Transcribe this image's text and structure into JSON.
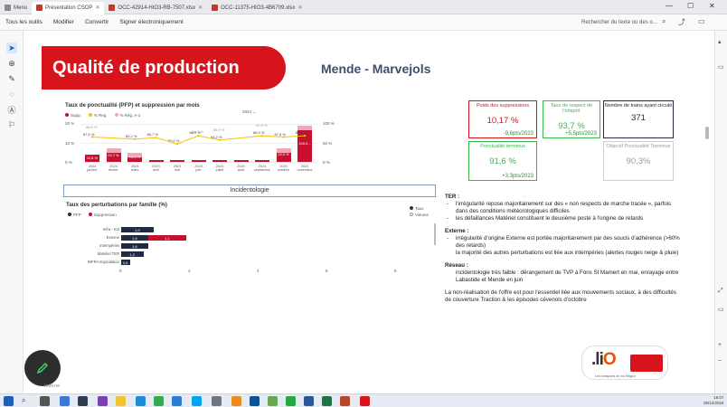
{
  "browser": {
    "tabs": [
      {
        "label": "Menu",
        "active": false
      },
      {
        "label": "Présentation CSOP",
        "active": true
      },
      {
        "label": "OCC-42914-HIO3-RB-7507.xlsx",
        "active": false
      },
      {
        "label": "OCC-11375-HIO3-4B6709.xlsx",
        "active": false
      }
    ]
  },
  "toolbar": {
    "items": [
      "Tous les outils",
      "Modifier",
      "Convertir",
      "Signer électroniquement"
    ],
    "search_placeholder": "Rechercher du texte ou des o..."
  },
  "slide": {
    "title": "Qualité de production",
    "subtitle": "Mende - Marvejols"
  },
  "bar_chart": {
    "title": "Taux de ponctualité (PFP) et suppression par mois",
    "year_filter": "2024",
    "legend": [
      "Supp.",
      "% Reg.",
      "% Rég. A-1"
    ],
    "y_ticks": [
      "20 %",
      "10 %",
      "0 %"
    ],
    "right_ticks": [
      "100 %",
      "50 %",
      "0 %"
    ]
  },
  "chart_data": {
    "type": "bar",
    "categories": [
      "janvier",
      "février",
      "mars",
      "avril",
      "mai",
      "juin",
      "juillet",
      "août",
      "septembre",
      "octobre",
      "novembre"
    ],
    "year": "2024",
    "series": [
      {
        "name": "Supp.",
        "values": [
          11.8,
          22.7,
          15.6,
          0.0,
          0.0,
          2.0,
          2.0,
          2.0,
          2.0,
          23.5,
          100.0
        ],
        "labels": [
          "11,8 %",
          "22,7 %",
          "15,6 %",
          "",
          "",
          "",
          "",
          "",
          "",
          "23,5 %",
          "100,0..."
        ]
      },
      {
        "name": "% Reg.",
        "values": [
          87.5,
          0,
          85.2,
          86.7,
          80.0,
          88.9,
          84.2,
          0,
          88.9,
          87.5,
          88.9
        ],
        "labels": [
          "87,5 %",
          "",
          "85,2 %",
          "86,7 %",
          "80,0 %",
          "88,9 %",
          "84,2 %",
          "",
          "88,9 %",
          "87,5 %",
          "88,9 %"
        ]
      },
      {
        "name": "% Rég. A-1",
        "values": [
          88.9,
          0,
          0,
          0,
          0,
          84.2,
          85.9,
          0,
          90.9,
          0,
          0
        ],
        "labels": [
          "88,9 %",
          "",
          "",
          "",
          "",
          "84,2 %",
          "85,9 %",
          "",
          "90,9 %",
          "",
          ""
        ]
      }
    ],
    "ylim": [
      0,
      20
    ],
    "y2lim": [
      0,
      100
    ]
  },
  "incident": {
    "header": "Incidentologie",
    "chart_title": "Taux des perturbations par famille (%)",
    "legend": [
      "PFP",
      "Suppression"
    ],
    "toggle": [
      "Taux",
      "Volume"
    ],
    "rows": [
      {
        "label": "Infra - Ext",
        "pfp": 1.9,
        "pfp_label": "1,9",
        "supp": 0,
        "supp_label": ""
      },
      {
        "label": "Externe",
        "pfp": 1.6,
        "pfp_label": "1,6",
        "supp": 1.1,
        "supp_label": "1,1"
      },
      {
        "label": "Intempéries",
        "pfp": 1.6,
        "pfp_label": "1,6",
        "supp": 0,
        "supp_label": ""
      },
      {
        "label": "Matériel TER",
        "pfp": 1.3,
        "pfp_label": "1,3",
        "supp": 0,
        "supp_label": ""
      },
      {
        "label": "INFRA Exploitation",
        "pfp": 0.5,
        "pfp_label": "0,5",
        "supp": 0,
        "supp_label": ""
      }
    ],
    "x_ticks": [
      "0",
      "2",
      "4",
      "6",
      "8"
    ]
  },
  "kpis": [
    {
      "title": "Poids des suppressions",
      "value": "10,17 %",
      "delta": "-9,6pts/2023",
      "color": "#d7141c",
      "value_color": "#d7141c",
      "delta_color": "#2e8b3e"
    },
    {
      "title": "Taux de respect de l'emport",
      "value": "93,7 %",
      "delta": "+5,5pts/2023",
      "color": "#3cb54a",
      "value_color": "#3cb54a",
      "delta_color": "#2e8b3e"
    },
    {
      "title": "Nombre de trains ayant circulé",
      "value": "371",
      "delta": "",
      "color": "#1f2a44",
      "value_color": "#1f2a44",
      "delta_color": "#333"
    },
    {
      "title": "Ponctualité terminus",
      "value": "91,6 %",
      "delta": "+3,3pts/2023",
      "color": "#3cb54a",
      "value_color": "#3cb54a",
      "delta_color": "#2e8b3e"
    },
    {
      "title": "Objectif Ponctualité Terminus",
      "value": "90,3%",
      "delta": "",
      "color": "#cfcfcf",
      "value_color": "#9a9a9a",
      "delta_color": "#999"
    }
  ],
  "text": {
    "ter_title": "TER :",
    "ter_items": [
      "l'irrégularité repose majoritairement sur des « non respects de marche tracée », parfois dans des conditions météorologiques difficiles",
      "les défaillances Matériel constituent le deuxième poste à l'origine de retards"
    ],
    "externe_title": "Externe :",
    "externe_items": [
      "irrégularité d'origine Externe est portée majoritairement par des soucis d'adhérence (>60% des retards)"
    ],
    "externe_sub": "la majorité des autres perturbations est liée aux intempéries (alertes rouges neige & pluie)",
    "reseau_title": "Réseau :",
    "reseau_text": "incidentologie très faible : dérangement de TVP à Fons St Mamert en mai, enrayage entre Labastide et Mende en juin",
    "conclusion": "La non-réalisation de l'offre est pour l'essentiel liée aux mouvements sociaux, à des difficultés de couverture Traction & les épisodes cévenols d'octobre"
  },
  "logo": {
    "text": "liO",
    "tagline": "Les transports de ma Région"
  },
  "footer": {
    "interne": "Interne"
  },
  "taskbar": {
    "time": "16:07",
    "date": "05/12/2024"
  }
}
